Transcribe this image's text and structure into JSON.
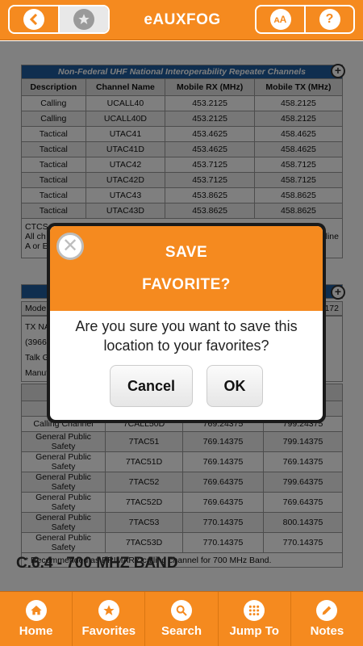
{
  "header": {
    "title": "eAUXFOG",
    "back_icon": "chevron-left-icon",
    "favorite_icon": "star-icon",
    "font_icon": "font-size-icon",
    "help_icon": "help-icon"
  },
  "table1": {
    "caption": "Non-Federal UHF National Interoperability Repeater Channels",
    "headers": [
      "Description",
      "Channel Name",
      "Mobile RX (MHz)",
      "Mobile TX (MHz)"
    ],
    "rows": [
      [
        "Calling",
        "UCALL40",
        "453.2125",
        "458.2125"
      ],
      [
        "Calling",
        "UCALL40D",
        "453.2125",
        "458.2125"
      ],
      [
        "Tactical",
        "UTAC41",
        "453.4625",
        "458.4625"
      ],
      [
        "Tactical",
        "UTAC41D",
        "453.4625",
        "458.4625"
      ],
      [
        "Tactical",
        "UTAC42",
        "453.7125",
        "458.7125"
      ],
      [
        "Tactical",
        "UTAC42D",
        "453.7125",
        "458.7125"
      ],
      [
        "Tactical",
        "UTAC43",
        "453.8625",
        "458.8625"
      ],
      [
        "Tactical",
        "UTAC43D",
        "453.8625",
        "458.8625"
      ]
    ],
    "note_line1": "CTCS",
    "note_line2": "All ch",
    "note_line2_right": "line",
    "note_line3": "A or E"
  },
  "table2": {
    "info_mode": "Mode",
    "info_mode_right": "172",
    "info_lines": [
      "TX NA",
      "(3966 -",
      "Talk G",
      "Manuf"
    ],
    "header_first": "Pr",
    "header_last": "z)",
    "partial_rows": [
      [
        "Call",
        "",
        "",
        ""
      ],
      [
        "Calling Channel",
        "7CALL50D",
        "769.24375",
        "799.24375"
      ]
    ],
    "rows": [
      [
        "General Public Safety",
        "7TAC51",
        "769.14375",
        "799.14375"
      ],
      [
        "General Public Safety",
        "7TAC51D",
        "769.14375",
        "769.14375"
      ],
      [
        "General Public Safety",
        "7TAC52",
        "769.64375",
        "799.64375"
      ],
      [
        "General Public Safety",
        "7TAC52D",
        "769.64375",
        "769.64375"
      ],
      [
        "General Public Safety",
        "7TAC53",
        "770.14375",
        "800.14375"
      ],
      [
        "General Public Safety",
        "7TAC53D",
        "770.14375",
        "770.14375"
      ]
    ],
    "footnote": "* Recommended as PRIMARY calling channel for 700 MHz Band."
  },
  "section_heading": "C.6.4 - 700 MHZ BAND",
  "dialog": {
    "title_line1": "SAVE",
    "title_line2": "FAVORITE?",
    "message": "Are you sure you want to save this location to your favorites?",
    "cancel_label": "Cancel",
    "ok_label": "OK",
    "close_icon": "close-icon"
  },
  "footer": {
    "tabs": [
      {
        "label": "Home",
        "icon": "home-icon"
      },
      {
        "label": "Favorites",
        "icon": "star-icon"
      },
      {
        "label": "Search",
        "icon": "search-icon"
      },
      {
        "label": "Jump To",
        "icon": "grid-icon"
      },
      {
        "label": "Notes",
        "icon": "pencil-icon"
      }
    ]
  },
  "colors": {
    "accent": "#f58a1f",
    "table_caption": "#1f5d9e"
  }
}
